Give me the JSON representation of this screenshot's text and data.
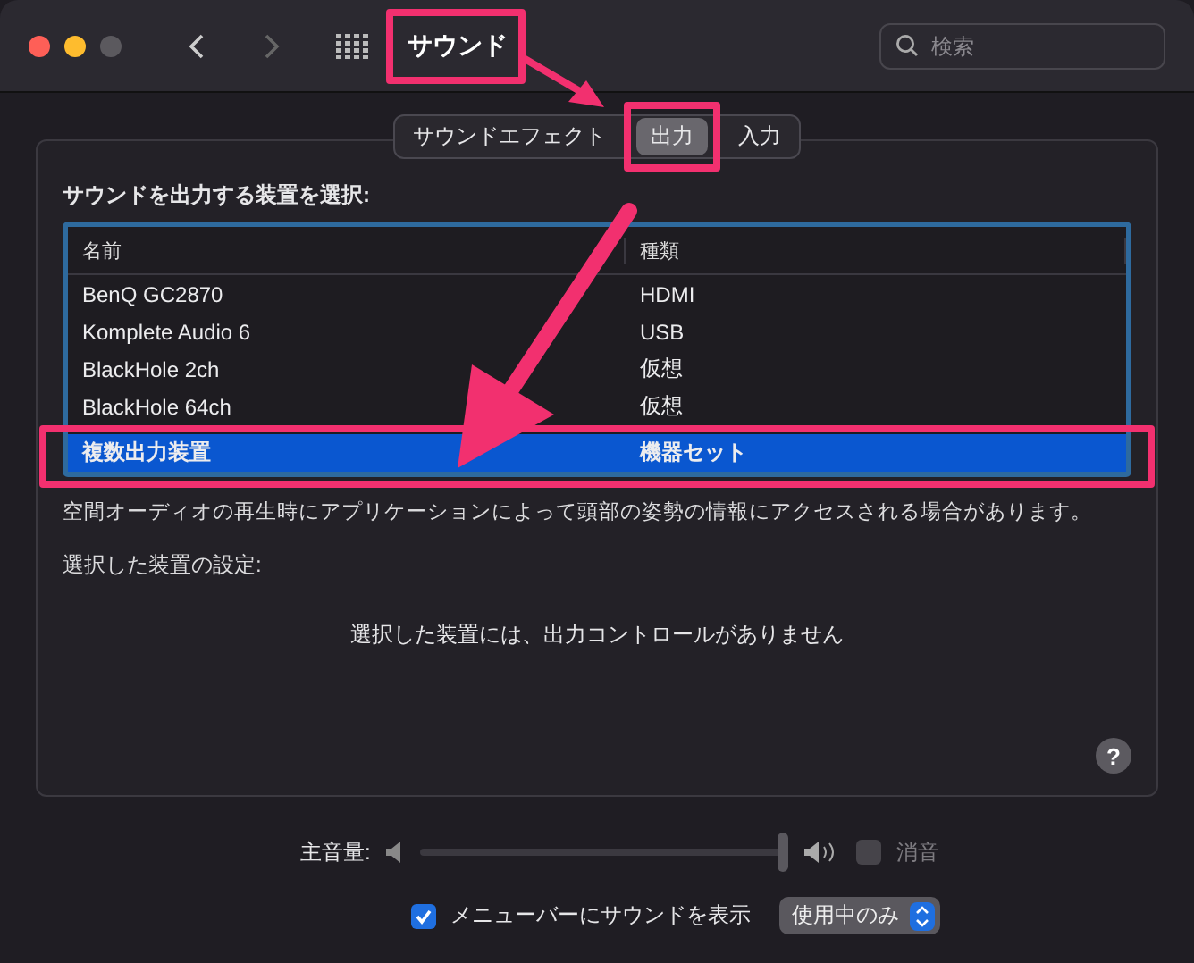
{
  "window": {
    "title": "サウンド"
  },
  "search": {
    "placeholder": "検索"
  },
  "tabs": [
    {
      "label": "サウンドエフェクト",
      "selected": false
    },
    {
      "label": "出力",
      "selected": true
    },
    {
      "label": "入力",
      "selected": false
    }
  ],
  "device_list": {
    "heading": "サウンドを出力する装置を選択:",
    "columns": [
      "名前",
      "種類"
    ],
    "rows": [
      {
        "name": "BenQ GC2870",
        "type": "HDMI",
        "selected": false
      },
      {
        "name": "Komplete Audio 6",
        "type": "USB",
        "selected": false
      },
      {
        "name": "BlackHole 2ch",
        "type": "仮想",
        "selected": false
      },
      {
        "name": "BlackHole 64ch",
        "type": "仮想",
        "selected": false
      },
      {
        "name": "複数出力装置",
        "type": "機器セット",
        "selected": true
      }
    ]
  },
  "spatial_audio_note": "空間オーディオの再生時にアプリケーションによって頭部の姿勢の情報にアクセスされる場合があります。",
  "settings": {
    "heading": "選択した装置の設定:",
    "message": "選択した装置には、出力コントロールがありません"
  },
  "help": "?",
  "volume": {
    "label": "主音量:",
    "level": 1,
    "mute": {
      "label": "消音",
      "checked": false
    }
  },
  "menu_bar": {
    "label": "メニューバーにサウンドを表示",
    "checked": true,
    "option": "使用中のみ"
  }
}
